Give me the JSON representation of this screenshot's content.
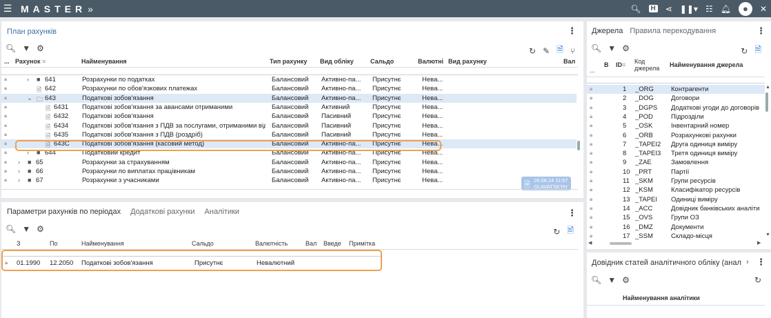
{
  "app": {
    "brand": "MASTER",
    "brand_suffix": "»"
  },
  "topbar_icons": [
    "search-icon",
    "h-icon",
    "share-icon",
    "pause-icon",
    "list-icon",
    "bell-icon",
    "avatar-icon",
    "close-icon"
  ],
  "chart_panel": {
    "title": "План рахунків",
    "columns": [
      "...",
      "Рахунок",
      "Найменування",
      "Тип рахунку",
      "Вид обліку",
      "Сальдо",
      "Валютні",
      "Вид рахунку",
      "Вал"
    ],
    "rows": [
      {
        "code": "641",
        "name": "Розрахунки по податках",
        "type": "Балансовий",
        "kind": "Активно-па...",
        "saldo": "Присутнє",
        "cur": "Нева...",
        "level": 1,
        "icon": "folder"
      },
      {
        "code": "642",
        "name": "Розрахунки по обов'язкових платежах",
        "type": "Балансовий",
        "kind": "Активно-па...",
        "saldo": "Присутнє",
        "cur": "Нева...",
        "level": 1,
        "icon": "doc"
      },
      {
        "code": "643",
        "name": "Податкові зобов'язання",
        "type": "Балансовий",
        "kind": "Активно-па...",
        "saldo": "Присутнє",
        "cur": "Нева...",
        "level": 1,
        "icon": "folder-open"
      },
      {
        "code": "6431",
        "name": "Податкові зобов'язання за авансами отриманими",
        "type": "Балансовий",
        "kind": "Активний",
        "saldo": "Присутнє",
        "cur": "Нева...",
        "level": 2,
        "icon": "doc"
      },
      {
        "code": "6432",
        "name": "Податкові зобов'язання",
        "type": "Балансовий",
        "kind": "Пасивний",
        "saldo": "Присутнє",
        "cur": "Нева...",
        "level": 2,
        "icon": "doc"
      },
      {
        "code": "6434",
        "name": "Податкові зобов'язання з ПДВ за послугами, отриманими від",
        "type": "Балансовий",
        "kind": "Пасивний",
        "saldo": "Присутнє",
        "cur": "Нева...",
        "level": 2,
        "icon": "doc"
      },
      {
        "code": "6435",
        "name": "Податкові зобов'язання з ПДВ (роздріб)",
        "type": "Балансовий",
        "kind": "Пасивний",
        "saldo": "Присутнє",
        "cur": "Нева...",
        "level": 2,
        "icon": "doc"
      },
      {
        "code": "643С",
        "name": "Податкові зобов'язання (касовий метод)",
        "type": "Балансовий",
        "kind": "Активно-па...",
        "saldo": "Присутнє",
        "cur": "Нева...",
        "level": 2,
        "icon": "doc"
      },
      {
        "code": "644",
        "name": "Податковий кредит",
        "type": "Балансовий",
        "kind": "Активно-па...",
        "saldo": "Присутнє",
        "cur": "Нева...",
        "level": 1,
        "icon": "folder"
      },
      {
        "code": "65",
        "name": "Розрахунки за страхуванням",
        "type": "Балансовий",
        "kind": "Активно-па...",
        "saldo": "Присутнє",
        "cur": "Нева...",
        "level": 0,
        "icon": "folder"
      },
      {
        "code": "66",
        "name": "Розрахунки по виплатах працівникам",
        "type": "Балансовий",
        "kind": "Активно-па...",
        "saldo": "Присутнє",
        "cur": "Нева...",
        "level": 0,
        "icon": "folder"
      },
      {
        "code": "67",
        "name": "Розрахунки з учасниками",
        "type": "Балансовий",
        "kind": "Активно-па...",
        "saldo": "Присутнє",
        "cur": "Нева...",
        "level": 0,
        "icon": "folder"
      }
    ],
    "badge": {
      "date": "26.06.14 11:57",
      "user": "GLAVATSKYH"
    }
  },
  "period_panel": {
    "tabs": [
      "Параметри рахунків по періодах",
      "Додаткові рахунки",
      "Аналітики"
    ],
    "columns": [
      "З",
      "По",
      "Найменування",
      "Сальдо",
      "Валютність",
      "Вал",
      "Введе",
      "Примітка"
    ],
    "row": {
      "from": "01.1990",
      "to": "12.2050",
      "name": "Податкові зобов'язання",
      "saldo": "Присутнє",
      "cur": "Невалютний"
    }
  },
  "sources_panel": {
    "tabs": [
      "Джерела",
      "Правила перекодування"
    ],
    "columns": [
      "В",
      "ID",
      "Код джерела",
      "Найменування джерела"
    ],
    "rows": [
      {
        "id": "1",
        "code": "_ORG",
        "name": "Контрагенти",
        "on": true
      },
      {
        "id": "2",
        "code": "_DOG",
        "name": "Договори",
        "on": true
      },
      {
        "id": "3",
        "code": "_DGPS",
        "name": "Додаткові угоди до договорів",
        "on": true
      },
      {
        "id": "4",
        "code": "_POD",
        "name": "Підрозділи",
        "on": true
      },
      {
        "id": "5",
        "code": "_OSK",
        "name": "Інвентарний номер",
        "on": true
      },
      {
        "id": "6",
        "code": "_ORB",
        "name": "Розрахункові рахунки",
        "on": true
      },
      {
        "id": "7",
        "code": "_TAPEI2",
        "name": "Друга одиниця виміру",
        "on": true
      },
      {
        "id": "8",
        "code": "_TAPEI3",
        "name": "Третя одиниця виміру",
        "on": false
      },
      {
        "id": "9",
        "code": "_ZAE",
        "name": "Замовлення",
        "on": true
      },
      {
        "id": "10",
        "code": "_PRT",
        "name": "Партії",
        "on": true
      },
      {
        "id": "11",
        "code": "_SKM",
        "name": "Групи ресурсів",
        "on": false
      },
      {
        "id": "12",
        "code": "_KSM",
        "name": "Класифікатор ресурсів",
        "on": true
      },
      {
        "id": "13",
        "code": "_TAPEI",
        "name": "Одиниці виміру",
        "on": true
      },
      {
        "id": "14",
        "code": "_ACC",
        "name": "Довідник банківських аналіти",
        "on": false
      },
      {
        "id": "15",
        "code": "_OVS",
        "name": "Групи ОЗ",
        "on": false
      },
      {
        "id": "16",
        "code": "_DMZ",
        "name": "Документи",
        "on": true
      },
      {
        "id": "17",
        "code": "_SSM",
        "name": "Складо-місця",
        "on": true
      }
    ]
  },
  "analytics_panel": {
    "title": "Довідник статей аналітичного обліку (анал",
    "column": "Найменування аналітики"
  }
}
